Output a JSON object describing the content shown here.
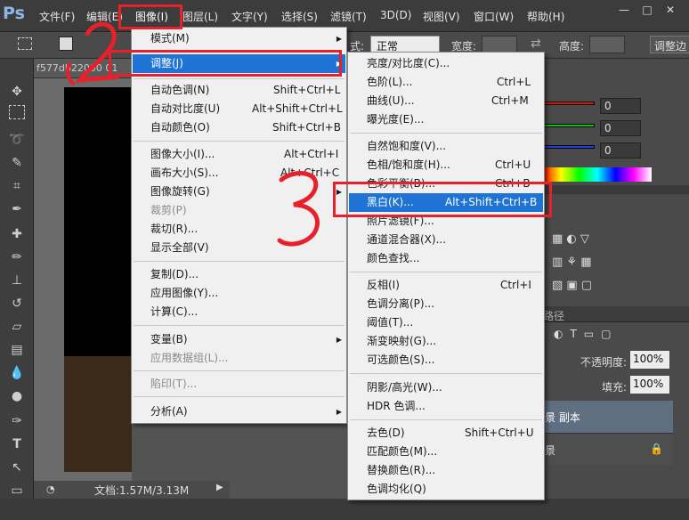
{
  "app": {
    "logo": "Ps"
  },
  "menubar": {
    "items": [
      "文件(F)",
      "编辑(E)",
      "图像(I)",
      "图层(L)",
      "文字(Y)",
      "选择(S)",
      "滤镜(T)",
      "3D(D)",
      "视图(V)",
      "窗口(W)",
      "帮助(H)"
    ]
  },
  "window_buttons": {
    "minimize": "—",
    "maximize": "□",
    "close": "✕"
  },
  "options_bar": {
    "style_label": "式:",
    "style_value": "正常",
    "width_label": "宽度:",
    "height_label": "高度:",
    "refine_label": "调整边"
  },
  "document": {
    "tab_title": "f577db22000 01",
    "status": "文档:1.57M/3.13M"
  },
  "image_menu": {
    "items": [
      {
        "label": "模式(M)",
        "shortcut": "",
        "submenu": true
      },
      {
        "label": "调整(J)",
        "shortcut": "",
        "submenu": true,
        "highlighted": true
      },
      {
        "label": "自动色调(N)",
        "shortcut": "Shift+Ctrl+L"
      },
      {
        "label": "自动对比度(U)",
        "shortcut": "Alt+Shift+Ctrl+L"
      },
      {
        "label": "自动颜色(O)",
        "shortcut": "Shift+Ctrl+B"
      },
      {
        "label": "图像大小(I)...",
        "shortcut": "Alt+Ctrl+I"
      },
      {
        "label": "画布大小(S)...",
        "shortcut": "Alt+Ctrl+C"
      },
      {
        "label": "图像旋转(G)",
        "shortcut": "",
        "submenu": true
      },
      {
        "label": "裁剪(P)",
        "shortcut": "",
        "disabled": true
      },
      {
        "label": "裁切(R)...",
        "shortcut": ""
      },
      {
        "label": "显示全部(V)",
        "shortcut": ""
      },
      {
        "label": "复制(D)...",
        "shortcut": ""
      },
      {
        "label": "应用图像(Y)...",
        "shortcut": ""
      },
      {
        "label": "计算(C)...",
        "shortcut": ""
      },
      {
        "label": "变量(B)",
        "shortcut": "",
        "submenu": true
      },
      {
        "label": "应用数据组(L)...",
        "shortcut": "",
        "disabled": true
      },
      {
        "label": "陷印(T)...",
        "shortcut": "",
        "disabled": true
      },
      {
        "label": "分析(A)",
        "shortcut": "",
        "submenu": true
      }
    ]
  },
  "adjust_menu": {
    "items": [
      {
        "label": "亮度/对比度(C)...",
        "shortcut": ""
      },
      {
        "label": "色阶(L)...",
        "shortcut": "Ctrl+L"
      },
      {
        "label": "曲线(U)...",
        "shortcut": "Ctrl+M"
      },
      {
        "label": "曝光度(E)...",
        "shortcut": ""
      },
      {
        "label": "自然饱和度(V)...",
        "shortcut": ""
      },
      {
        "label": "色相/饱和度(H)...",
        "shortcut": "Ctrl+U"
      },
      {
        "label": "色彩平衡(B)...",
        "shortcut": "Ctrl+B"
      },
      {
        "label": "黑白(K)...",
        "shortcut": "Alt+Shift+Ctrl+B",
        "highlighted": true
      },
      {
        "label": "照片滤镜(F)...",
        "shortcut": ""
      },
      {
        "label": "通道混合器(X)...",
        "shortcut": ""
      },
      {
        "label": "颜色查找...",
        "shortcut": ""
      },
      {
        "label": "反相(I)",
        "shortcut": "Ctrl+I"
      },
      {
        "label": "色调分离(P)...",
        "shortcut": ""
      },
      {
        "label": "阈值(T)...",
        "shortcut": ""
      },
      {
        "label": "渐变映射(G)...",
        "shortcut": ""
      },
      {
        "label": "可选颜色(S)...",
        "shortcut": ""
      },
      {
        "label": "阴影/高光(W)...",
        "shortcut": ""
      },
      {
        "label": "HDR 色调...",
        "shortcut": ""
      },
      {
        "label": "去色(D)",
        "shortcut": "Shift+Ctrl+U"
      },
      {
        "label": "匹配颜色(M)...",
        "shortcut": ""
      },
      {
        "label": "替换颜色(R)...",
        "shortcut": ""
      },
      {
        "label": "色调均化(Q)",
        "shortcut": ""
      }
    ]
  },
  "right_panel": {
    "color_values": [
      "0",
      "0",
      "0"
    ],
    "paths_tab": "路径",
    "opacity_label": "不透明度:",
    "opacity_value": "100%",
    "fill_label": "填充:",
    "fill_value": "100%",
    "layer_copy": "景 副本",
    "layer_bg": "景"
  },
  "annotations": {
    "two": "2",
    "three": "3"
  },
  "colors": {
    "accent_highlight": "#1e73d4",
    "annotation_red": "#e8202a"
  }
}
